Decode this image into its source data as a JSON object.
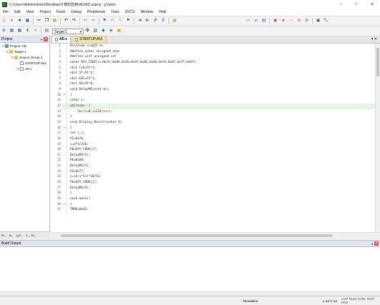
{
  "window": {
    "title": "C:\\Users\\Administrator\\Desktop\\计算机控制\\AD\\AD.uvproj - µVision",
    "controls": [
      "–",
      "□",
      "✕"
    ]
  },
  "menu": [
    "File",
    "Edit",
    "View",
    "Project",
    "Flash",
    "Debug",
    "Peripherals",
    "Tools",
    "SVCS",
    "Window",
    "Help"
  ],
  "toolbar": {
    "target": "Target 1"
  },
  "project_panel": {
    "title": "Project",
    "tree": [
      {
        "label": "Project: AD",
        "level": 0,
        "exp": "⊟",
        "icon": "proj"
      },
      {
        "label": "Target 1",
        "level": 1,
        "exp": "⊟",
        "icon": "folder"
      },
      {
        "label": "Source Group 1",
        "level": 2,
        "exp": "⊟",
        "icon": "folder"
      },
      {
        "label": "STARTUP.A51",
        "level": 3,
        "exp": "",
        "icon": "file"
      },
      {
        "label": "AD.c",
        "level": 3,
        "exp": "⊞",
        "icon": "file"
      }
    ],
    "tabs": [
      "Pr...",
      "B...",
      "{} F...",
      "0→ Te..."
    ]
  },
  "editor": {
    "tabs": [
      {
        "label": "AD.c",
        "active": true
      },
      {
        "label": "STARTUP.A51",
        "active": false
      }
    ],
    "lines": [
      {
        "n": "1",
        "fold": "",
        "code": "#include <reg51.h>"
      },
      {
        "n": "2",
        "fold": "",
        "code": "#define uchar unsigned char"
      },
      {
        "n": "3",
        "fold": "",
        "code": "#define uint unsigned int"
      },
      {
        "n": "4",
        "fold": "",
        "code": "uchar DSY_CODE[]={0x3f,0x06,0x5b,0x4f,0x66,0x6d,0x7d,0x07,0x7f,0x6f};"
      },
      {
        "n": "5",
        "fold": "",
        "code": "sbit CLK=P1^3;"
      },
      {
        "n": "6",
        "fold": "",
        "code": "sbit ST=P1^2;"
      },
      {
        "n": "7",
        "fold": "",
        "code": "sbit EOC=P1^1;"
      },
      {
        "n": "8",
        "fold": "",
        "code": "sbit OE=P1^0;"
      },
      {
        "n": "9",
        "fold": "",
        "code": "void DelayMS(uint ms)"
      },
      {
        "n": "10",
        "fold": "⊟",
        "code": "{"
      },
      {
        "n": "11",
        "fold": "",
        "code": "uchar i;"
      },
      {
        "n": "12",
        "fold": "",
        "code": "while(ms--)"
      },
      {
        "n": "13",
        "fold": "",
        "code": "    for(i=0;i<120;i++);"
      },
      {
        "n": "14",
        "fold": "",
        "code": "}"
      },
      {
        "n": "15",
        "fold": "",
        "code": "void Display_Result(uchar d)"
      },
      {
        "n": "16",
        "fold": "⊟",
        "code": "{"
      },
      {
        "n": "17",
        "fold": "",
        "code": "int i,j;"
      },
      {
        "n": "18",
        "fold": "",
        "code": "P2=0xfb;"
      },
      {
        "n": "19",
        "fold": "",
        "code": "i=d*5/256;"
      },
      {
        "n": "20",
        "fold": "",
        "code": "P0=DSY_CODE[i];"
      },
      {
        "n": "21",
        "fold": "",
        "code": "DelayMS(5);"
      },
      {
        "n": "22",
        "fold": "",
        "code": "P0=0x00;"
      },
      {
        "n": "23",
        "fold": "",
        "code": "DelayMS(5);"
      },
      {
        "n": "24",
        "fold": "",
        "code": "P2=0xf7;"
      },
      {
        "n": "25",
        "fold": "",
        "code": "j=(d-i*51)*10/51;"
      },
      {
        "n": "26",
        "fold": "",
        "code": "P0=DSY_CODE[j];"
      },
      {
        "n": "27",
        "fold": "",
        "code": "DelayMS(5);"
      },
      {
        "n": "28",
        "fold": "",
        "code": "}"
      },
      {
        "n": "29",
        "fold": "",
        "code": "void main()"
      },
      {
        "n": "30",
        "fold": "⊟",
        "code": "{"
      },
      {
        "n": "31",
        "fold": "",
        "code": "TMOD=0x02;"
      }
    ]
  },
  "build_output": {
    "title": "Build Output"
  },
  "status": {
    "simulation": "Simulation",
    "position": "L:12 C:12",
    "flags": "CAP NUM SCRL OVR R/W"
  }
}
